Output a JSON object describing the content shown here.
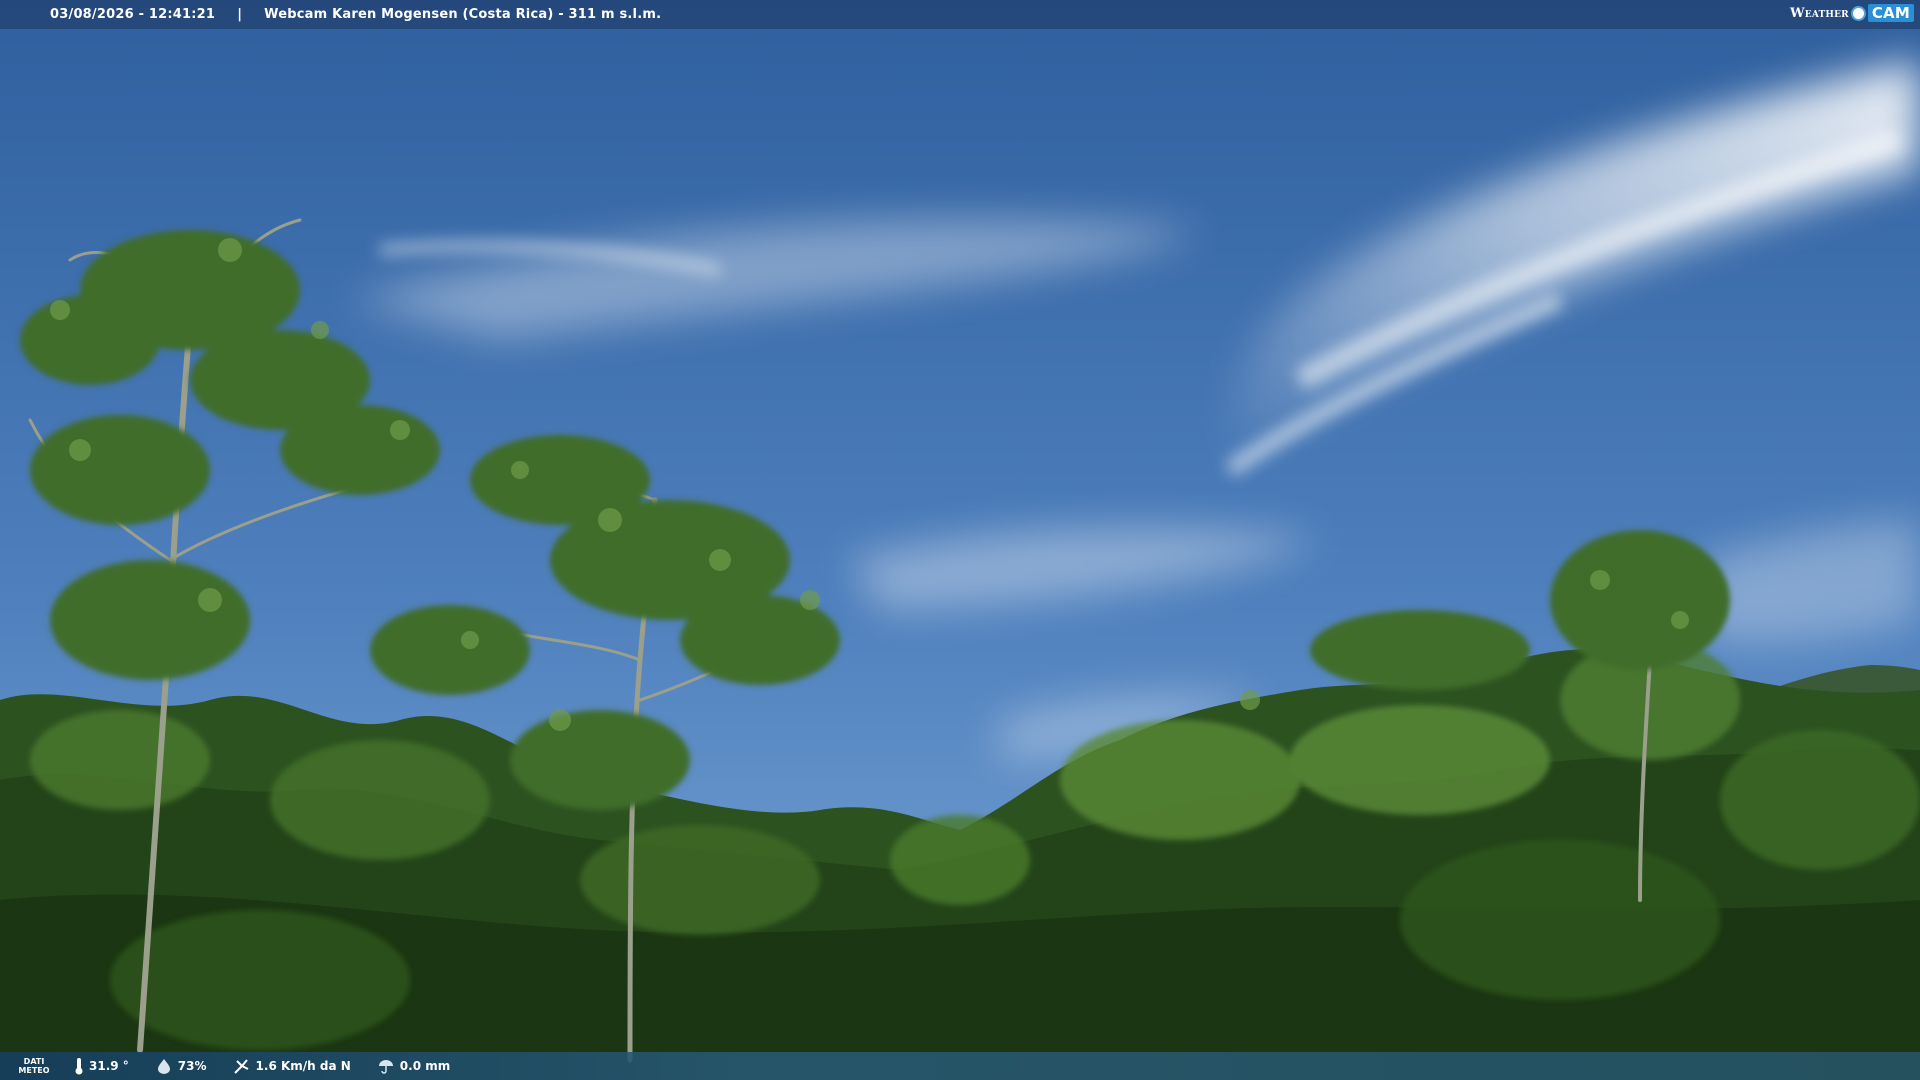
{
  "header": {
    "datetime": "03/08/2026 - 12:41:21",
    "separator": "|",
    "title": "Webcam Karen Mogensen (Costa Rica) - 311 m s.l.m.",
    "brand_left": "Weather",
    "brand_right": "CAM"
  },
  "weather_bar": {
    "label_line1": "DATI",
    "label_line2": "METEO",
    "temperature": "31.9 °",
    "humidity": "73%",
    "wind": "1.6 Km/h da N",
    "rain": "0.0 mm",
    "icons": [
      "thermometer-icon",
      "humidity-icon",
      "wind-icon",
      "rain-icon"
    ]
  },
  "colors": {
    "sky_top": "#2f5f9e",
    "sky_bottom": "#6c9bcf",
    "foliage_dark": "#1d3d14",
    "foliage_light": "#5f8f3a"
  }
}
